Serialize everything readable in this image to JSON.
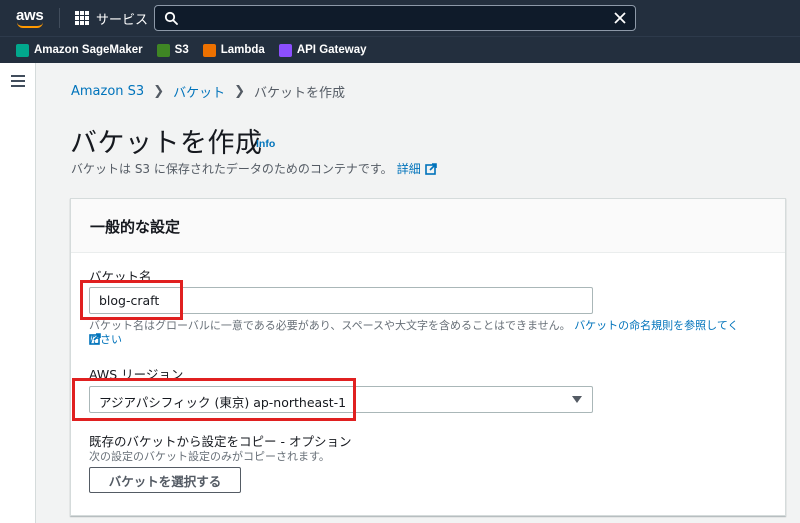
{
  "topnav": {
    "logo_text": "aws",
    "services_label": "サービス",
    "search_value": ""
  },
  "favorites": [
    {
      "label": "Amazon SageMaker",
      "icon": "sagemaker-icon",
      "color": "#01a88d"
    },
    {
      "label": "S3",
      "icon": "s3-icon",
      "color": "#3f8624"
    },
    {
      "label": "Lambda",
      "icon": "lambda-icon",
      "color": "#ed7100"
    },
    {
      "label": "API Gateway",
      "icon": "api-gateway-icon",
      "color": "#8c4fff"
    }
  ],
  "breadcrumb": {
    "items": [
      "Amazon S3",
      "バケット",
      "バケットを作成"
    ]
  },
  "page": {
    "title": "バケットを作成",
    "info": "Info",
    "subtitle": "バケットは S3 に保存されたデータのためのコンテナです。",
    "detail_link": "詳細"
  },
  "general": {
    "header": "一般的な設定",
    "bucket_name_label": "バケット名",
    "bucket_name_value": "blog-craft",
    "bucket_name_hint": "バケット名はグローバルに一意である必要があり、スペースや大文字を含めることはできません。",
    "bucket_name_hint_link": "バケットの命名規則を参照してください",
    "region_label": "AWS リージョン",
    "region_value": "アジアパシフィック (東京) ap-northeast-1",
    "copy_label": "既存のバケットから設定をコピー - オプション",
    "copy_desc": "次の設定のバケット設定のみがコピーされます。",
    "choose_bucket_button": "バケットを選択する"
  },
  "colors": {
    "nav_bg": "#232f3e",
    "link": "#0073bb",
    "highlight": "#e02020",
    "aws_orange": "#ff9900"
  }
}
